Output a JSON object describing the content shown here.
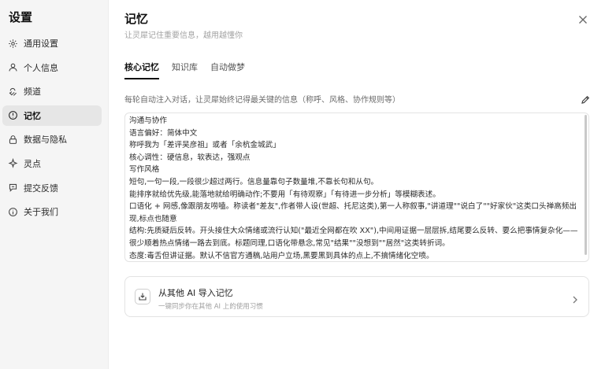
{
  "sidebar": {
    "title": "设置",
    "items": [
      {
        "label": "通用设置",
        "icon": "gear-icon"
      },
      {
        "label": "个人信息",
        "icon": "user-icon"
      },
      {
        "label": "频道",
        "icon": "channel-icon"
      },
      {
        "label": "记忆",
        "icon": "memory-icon"
      },
      {
        "label": "数据与隐私",
        "icon": "lock-icon"
      },
      {
        "label": "灵点",
        "icon": "sparkle-icon"
      },
      {
        "label": "提交反馈",
        "icon": "feedback-icon"
      },
      {
        "label": "关于我们",
        "icon": "info-icon"
      }
    ],
    "active_index": 3
  },
  "header": {
    "title": "记忆",
    "subtitle": "让灵犀记住重要信息，越用越懂你"
  },
  "tabs": [
    {
      "label": "核心记忆",
      "active": true
    },
    {
      "label": "知识库",
      "active": false
    },
    {
      "label": "自动做梦",
      "active": false
    }
  ],
  "core_memory": {
    "description": "每轮自动注入对话，让灵犀始终记得最关键的信息（称呼、风格、协作规则等）",
    "text": "沟通与协作\n语言偏好：简体中文\n称呼我为「差评吴彦祖」或者「余杭金城武」\n核心调性：硬信息，软表达，强观点\n写作风格\n短句,一句一段,一段很少超过两行。信息量靠句子数量堆,不靠长句和从句。\n能排序就给优先级,能落地就给明确动作;不要用「有待观察」「有待进一步分析」等模糊表述。\n口语化 + 网感,像跟朋友唠嗑。称读者\"差友\",作者带人设(世超、托尼这类),第一人称叙事,\"讲道理\"\"说白了\"\"好家伙\"这类口头禅高频出现,标点也随意\n结构:先质疑后反转。开头接住大众情绪或流行认知(\"最近全网都在吹 XX\"),中间用证据一层层拆,结尾要么反转、要么把事情复杂化——很少顺着热点情绪一路去到底。标题同理,口语化带悬念,常见\"结果\"\"没想到\"\"居然\"这类转折词。\n态度:毒舌但讲证据。默认不信官方通稿,站用户立场,黑要黑到具体的点上,不搞情绪化空喷。"
  },
  "import_card": {
    "title": "从其他 AI 导入记忆",
    "subtitle": "一键同步你在其他 AI 上的使用习惯"
  },
  "colors": {
    "sidebar_bg": "#f5f5f5",
    "active_item_bg": "#e6e6e6",
    "muted_text": "#a3a3a3",
    "border": "#e3e3e3"
  }
}
